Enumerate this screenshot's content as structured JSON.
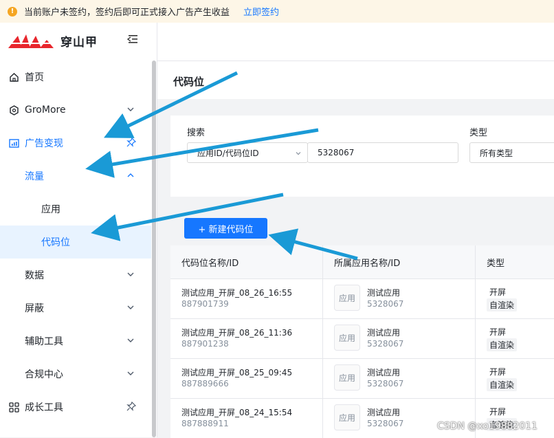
{
  "notice": {
    "message": "当前账户未签约，签约后即可正式接入广告产生收益",
    "link": "立即签约",
    "icon": "warning-icon"
  },
  "logo": {
    "brand": "穿山甲"
  },
  "menu": [
    {
      "label": "首页",
      "icon": "home-icon"
    },
    {
      "label": "GroMore",
      "icon": "hexagon-icon",
      "chevron": "down"
    },
    {
      "label": "广告变现",
      "icon": "chart-icon",
      "pinned": true,
      "selected": true
    },
    {
      "label": "流量",
      "chevron": "up",
      "selected": true
    },
    {
      "label": "应用"
    },
    {
      "label": "代码位",
      "active": true
    },
    {
      "label": "数据",
      "chevron": "down"
    },
    {
      "label": "屏蔽",
      "chevron": "down"
    },
    {
      "label": "辅助工具",
      "chevron": "down"
    },
    {
      "label": "合规中心",
      "chevron": "down"
    },
    {
      "label": "成长工具",
      "icon": "grid-icon",
      "pinned": true
    }
  ],
  "page": {
    "title": "代码位"
  },
  "search": {
    "label": "搜索",
    "select_value": "应用ID/代码位ID",
    "input_value": "5328067",
    "type_label": "类型",
    "type_value": "所有类型"
  },
  "new_button": "+ 新建代码位",
  "table": {
    "headers": [
      "代码位名称/ID",
      "所属应用名称/ID",
      "类型"
    ],
    "rows": [
      {
        "name": "测试应用_开屏_08_26_16:55",
        "id": "887901739",
        "app_icon": "应用",
        "app": "测试应用",
        "app_id": "5328067",
        "type": "开屏",
        "tag": "自渲染"
      },
      {
        "name": "测试应用_开屏_08_26_11:36",
        "id": "887901238",
        "app_icon": "应用",
        "app": "测试应用",
        "app_id": "5328067",
        "type": "开屏",
        "tag": "自渲染"
      },
      {
        "name": "测试应用_开屏_08_25_09:45",
        "id": "887889666",
        "app_icon": "应用",
        "app": "测试应用",
        "app_id": "5328067",
        "type": "开屏",
        "tag": "自渲染"
      },
      {
        "name": "测试应用_开屏_08_24_15:54",
        "id": "887888911",
        "app_icon": "应用",
        "app": "测试应用",
        "app_id": "5328067",
        "type": "开屏",
        "tag": "自渲染"
      }
    ]
  },
  "watermark": "CSDN @xo19882011",
  "colors": {
    "accent": "#1677ff",
    "arrow": "#1a9ad6",
    "active_bg": "#e8f3ff"
  }
}
